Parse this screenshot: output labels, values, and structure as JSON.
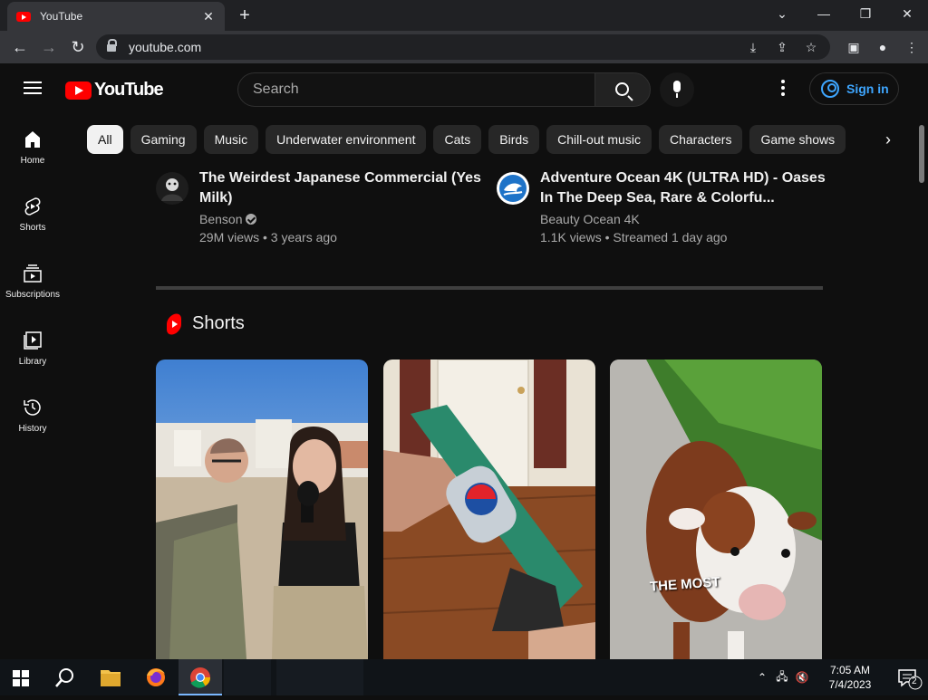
{
  "browser": {
    "tab_title": "YouTube",
    "url": "youtube.com",
    "window_controls": [
      "⌄",
      "—",
      "❐",
      "✕"
    ]
  },
  "yt": {
    "logo_text": "YouTube",
    "search_placeholder": "Search",
    "sign_in": "Sign in"
  },
  "sidebar": {
    "items": [
      {
        "label": "Home",
        "icon": "home-icon"
      },
      {
        "label": "Shorts",
        "icon": "shorts-icon"
      },
      {
        "label": "Subscriptions",
        "icon": "subscriptions-icon"
      },
      {
        "label": "Library",
        "icon": "library-icon"
      },
      {
        "label": "History",
        "icon": "history-icon"
      }
    ]
  },
  "chips": [
    "All",
    "Gaming",
    "Music",
    "Underwater environment",
    "Cats",
    "Birds",
    "Chill-out music",
    "Characters",
    "Game shows"
  ],
  "videos": [
    {
      "title": "The Weirdest Japanese Commercial (Yes Milk)",
      "channel": "Benson",
      "verified": true,
      "stats": "29M views • 3 years ago"
    },
    {
      "title": "Adventure Ocean 4K (ULTRA HD) - Oases In The Deep Sea, Rare & Colorfu...",
      "channel": "Beauty Ocean 4K",
      "verified": false,
      "stats": "1.1K views • Streamed 1 day ago"
    }
  ],
  "shorts": {
    "title": "Shorts",
    "items": [
      {
        "overlay": ""
      },
      {
        "overlay": ""
      },
      {
        "overlay": "THE MOST"
      }
    ]
  },
  "taskbar": {
    "time": "7:05 AM",
    "date": "7/4/2023",
    "notifications": "2"
  }
}
